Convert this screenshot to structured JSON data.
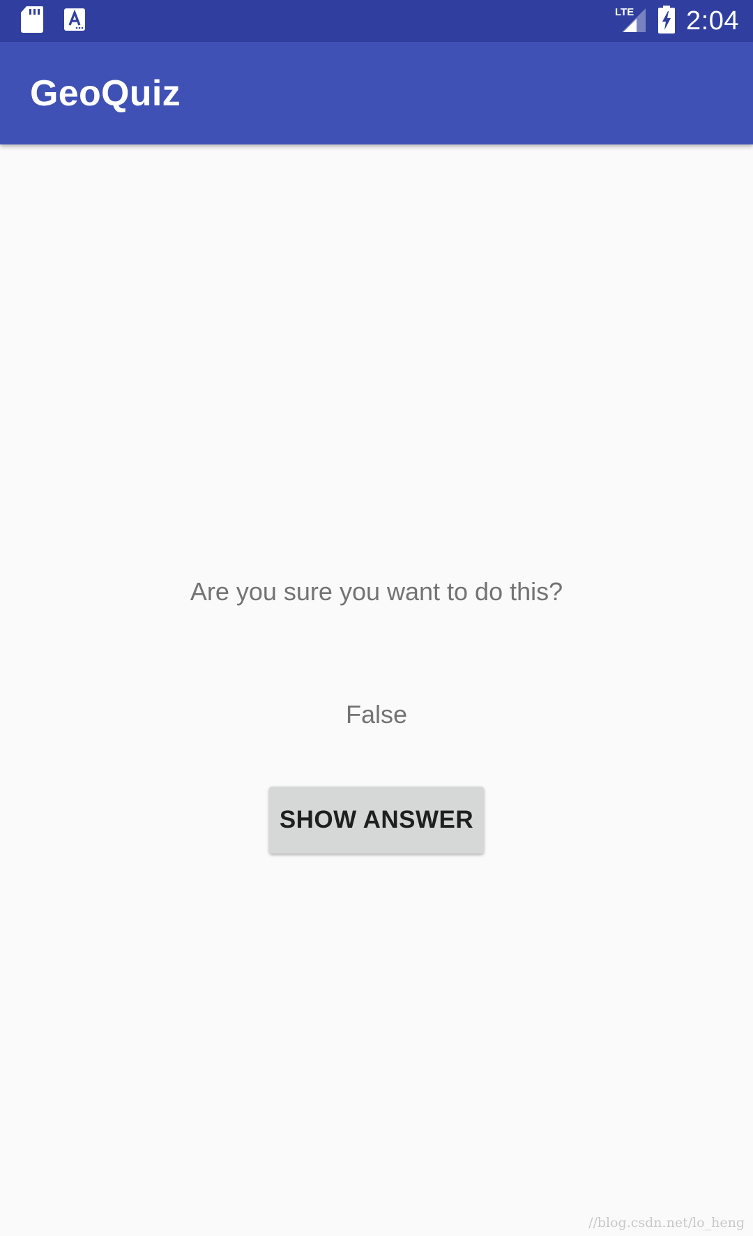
{
  "status_bar": {
    "time": "2:04",
    "network_label": "LTE",
    "icons": [
      "sd-card-icon",
      "font-a-icon",
      "lte-signal-icon",
      "battery-charging-icon"
    ],
    "background_color": "#303f9f"
  },
  "app_bar": {
    "title": "GeoQuiz",
    "background_color": "#3f51b5"
  },
  "main": {
    "question": "Are you sure you want to do this?",
    "answer": "False",
    "show_answer_label": "SHOW ANSWER"
  },
  "watermark": "//blog.csdn.net/lo_heng"
}
